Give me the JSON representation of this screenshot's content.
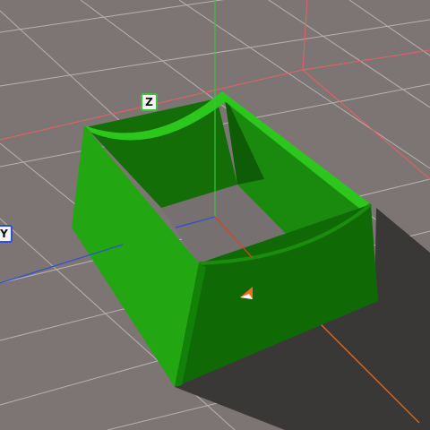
{
  "viewport": {
    "background": "#7d7574",
    "model_color": "#22aa11",
    "shadow_color": "#3a3837",
    "grid_color": "#c8c4c3",
    "boundary_color": "#e86060"
  },
  "axes": {
    "z": {
      "label": "Z",
      "color": "#3fbf3f"
    },
    "y": {
      "label": "Y",
      "color": "#2f4fd8"
    },
    "x": {
      "color": "#ff6a1f"
    }
  },
  "icons": {
    "orientation_marker": "origin-marker-icon"
  }
}
